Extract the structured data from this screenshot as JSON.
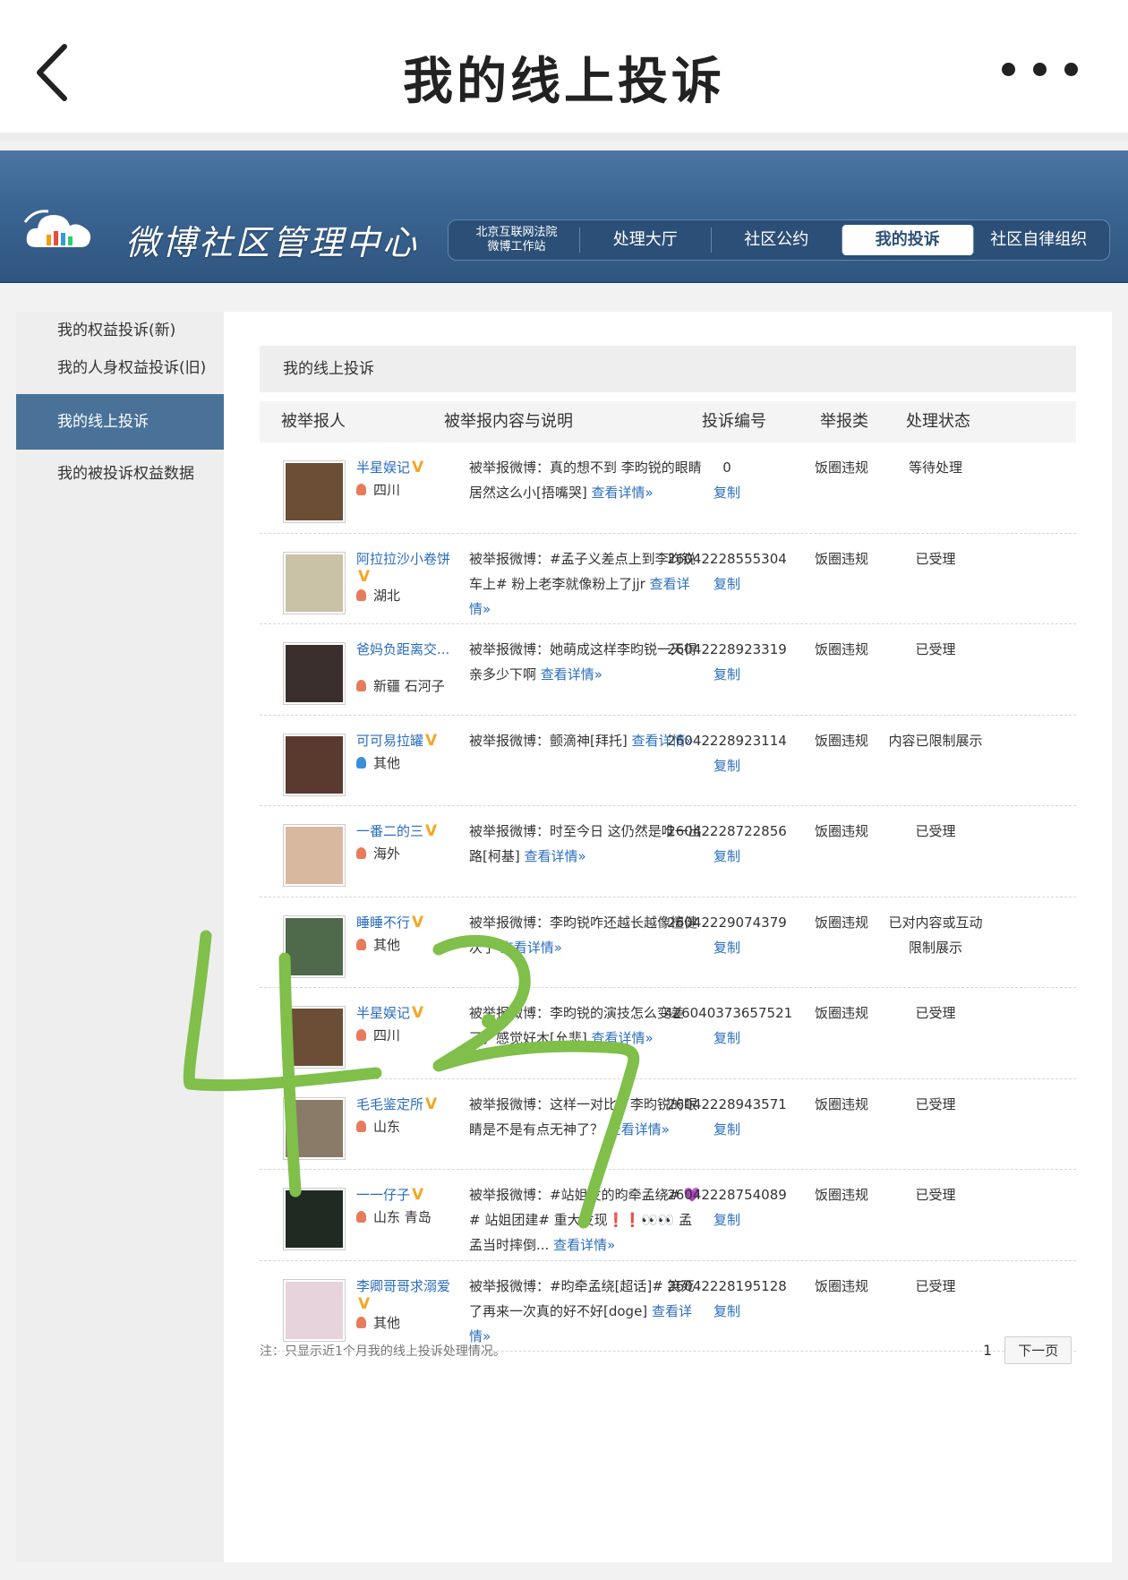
{
  "app": {
    "title": "我的线上投诉"
  },
  "banner": {
    "title": "微博社区管理中心",
    "nav_tiny": [
      "北京互联网法院",
      "微博工作站"
    ],
    "nav": [
      {
        "label": "处理大厅",
        "active": false
      },
      {
        "label": "社区公约",
        "active": false
      },
      {
        "label": "我的投诉",
        "active": true
      },
      {
        "label": "社区自律组织",
        "active": false
      }
    ]
  },
  "sidebar": {
    "items": [
      {
        "label": "我的权益投诉(新)",
        "active": false
      },
      {
        "label": "我的人身权益投诉(旧)",
        "active": false
      },
      {
        "label": "我的线上投诉",
        "active": true
      },
      {
        "label": "我的被投诉权益数据",
        "active": false
      }
    ]
  },
  "content": {
    "heading": "我的线上投诉",
    "columns": [
      "被举报人",
      "被举报内容与说明",
      "投诉编号",
      "举报类",
      "处理状态"
    ],
    "copy_label": "复制",
    "more_label": "查看详情»",
    "rows": [
      {
        "user": "半星娱记",
        "verified": true,
        "location": "四川",
        "gender": "female",
        "desc": "被举报微博：真的想不到 李昀锐的眼睛居然这么小[捂嘴哭]",
        "id": "0",
        "type": "饭圈违规",
        "status": "等待处理",
        "avatar_color": "#6b4e35"
      },
      {
        "user": "阿拉拉沙小卷饼",
        "verified": true,
        "location": "湖北",
        "gender": "female",
        "desc": "被举报微博：#孟子义差点上到李昀锐车上# 粉上老李就像粉上了jjr",
        "id": "26042228555304",
        "type": "饭圈违规",
        "status": "已受理",
        "avatar_color": "#c9c2a6"
      },
      {
        "user": "爸妈负距离交...",
        "verified": false,
        "location": "新疆 石河子",
        "gender": "female",
        "desc": "被举报微博：她萌成这样李昀锐一天得亲多少下啊",
        "id": "26042228923319",
        "type": "饭圈违规",
        "status": "已受理",
        "avatar_color": "#3a2f2c"
      },
      {
        "user": "可可易拉罐",
        "verified": true,
        "location": "其他",
        "gender": "male",
        "desc": "被举报微博：颤滴神[拜托]",
        "id": "26042228923114",
        "type": "饭圈违规",
        "status": "内容已限制展示",
        "avatar_color": "#5a3a2e"
      },
      {
        "user": "一番二的三",
        "verified": true,
        "location": "海外",
        "gender": "female",
        "desc": "被举报微博：时至今日 这仍然是唯一出路[柯基]",
        "id": "26042228722856",
        "type": "饭圈违规",
        "status": "已受理",
        "avatar_color": "#d9b8a0"
      },
      {
        "user": "睡睡不行",
        "verified": true,
        "location": "其他",
        "gender": "female",
        "desc": "被举报微博：李昀锐咋还越长越像檀健次了",
        "id": "26042229074379",
        "type": "饭圈违规",
        "status": "已对内容或互动限制展示",
        "avatar_color": "#4e6a4a"
      },
      {
        "user": "半星娱记",
        "verified": true,
        "location": "四川",
        "gender": "female",
        "desc": "被举报微博：李昀锐的演技怎么变差了，感觉好木[允悲]",
        "id": "426040373657521",
        "type": "饭圈违规",
        "status": "已受理",
        "avatar_color": "#6b4e35"
      },
      {
        "user": "毛毛鉴定所",
        "verified": true,
        "location": "山东",
        "gender": "female",
        "desc": "被举报微博：这样一对比，李昀锐的眼睛是不是有点无神了？",
        "id": "26042228943571",
        "type": "饭圈违规",
        "status": "已受理",
        "avatar_color": "#8a7a68"
      },
      {
        "user": "一一仔子",
        "verified": true,
        "location": "山东 青岛",
        "gender": "female",
        "desc": "被举报微博：#站姐发的昀牵孟绕# 💜# 站姐团建# 重大发现❗❗👀👀 孟孟当时摔倒...",
        "id": "26042228754089",
        "type": "饭圈违规",
        "status": "已受理",
        "avatar_color": "#1e2a22"
      },
      {
        "user": "李卿哥哥求溺爱",
        "verified": true,
        "location": "其他",
        "gender": "female",
        "desc": "被举报微博：#昀牵孟绕[超话]# 笑死了再来一次真的好不好[doge]",
        "id": "26042228195128",
        "type": "饭圈违规",
        "status": "已受理",
        "avatar_color": "#e6d3dc"
      }
    ],
    "note": "注：只显示近1个月我的线上投诉处理情况。",
    "pager": {
      "page": "1",
      "next": "下一页"
    }
  },
  "overlay": {
    "handwriting": "4.27",
    "color": "#7fbf4a"
  },
  "colors": {
    "accent": "#2a6dbf",
    "banner": "#3b6593",
    "verified": "#f5a623"
  }
}
